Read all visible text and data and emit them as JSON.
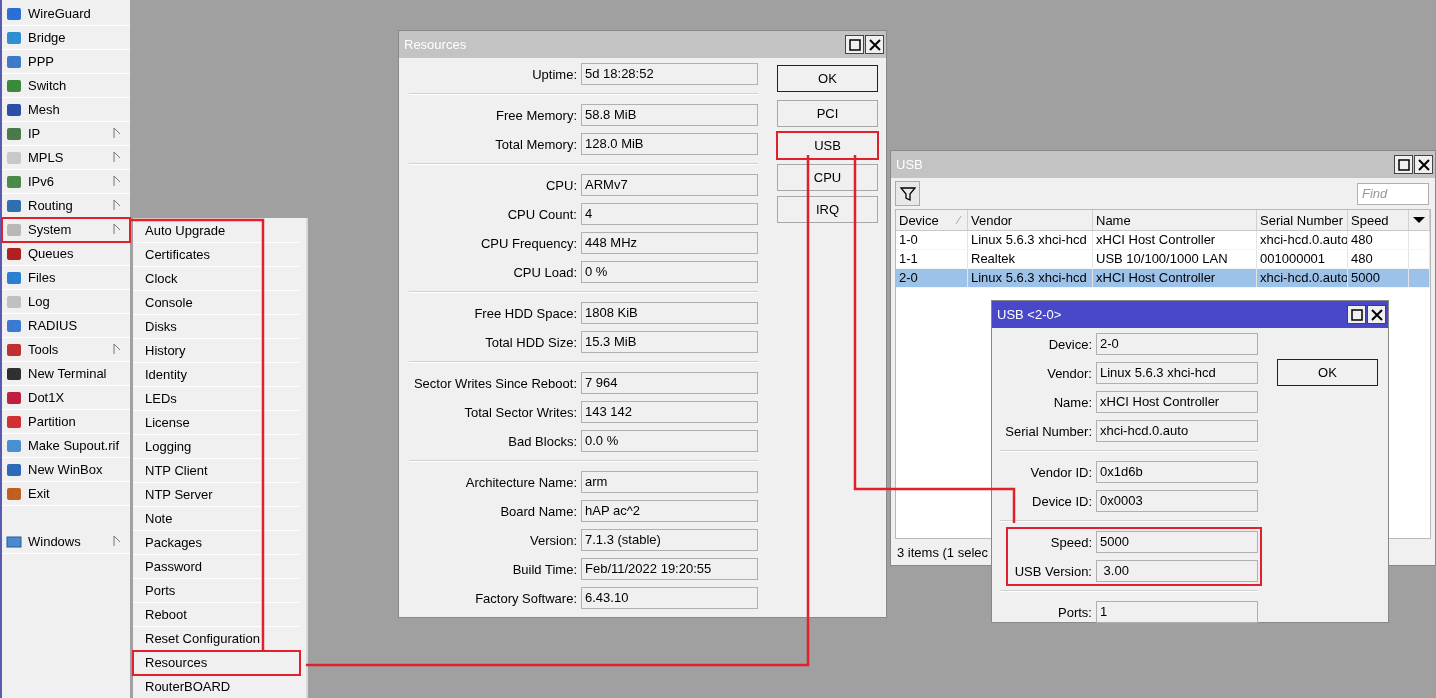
{
  "sidebar": {
    "items": [
      {
        "label": "WireGuard",
        "has_submenu": false,
        "marked": false
      },
      {
        "label": "Bridge",
        "has_submenu": false,
        "marked": false
      },
      {
        "label": "PPP",
        "has_submenu": false,
        "marked": false
      },
      {
        "label": "Switch",
        "has_submenu": false,
        "marked": false
      },
      {
        "label": "Mesh",
        "has_submenu": false,
        "marked": false
      },
      {
        "label": "IP",
        "has_submenu": true,
        "marked": false
      },
      {
        "label": "MPLS",
        "has_submenu": true,
        "marked": false
      },
      {
        "label": "IPv6",
        "has_submenu": true,
        "marked": false
      },
      {
        "label": "Routing",
        "has_submenu": true,
        "marked": false
      },
      {
        "label": "System",
        "has_submenu": true,
        "marked": true
      },
      {
        "label": "Queues",
        "has_submenu": false,
        "marked": false
      },
      {
        "label": "Files",
        "has_submenu": false,
        "marked": false
      },
      {
        "label": "Log",
        "has_submenu": false,
        "marked": false
      },
      {
        "label": "RADIUS",
        "has_submenu": false,
        "marked": false
      },
      {
        "label": "Tools",
        "has_submenu": true,
        "marked": false
      },
      {
        "label": "New Terminal",
        "has_submenu": false,
        "marked": false
      },
      {
        "label": "Dot1X",
        "has_submenu": false,
        "marked": false
      },
      {
        "label": "Partition",
        "has_submenu": false,
        "marked": false
      },
      {
        "label": "Make Supout.rif",
        "has_submenu": false,
        "marked": false
      },
      {
        "label": "New WinBox",
        "has_submenu": false,
        "marked": false
      },
      {
        "label": "Exit",
        "has_submenu": false,
        "marked": false
      }
    ],
    "bottom_items": [
      {
        "label": "Windows",
        "has_submenu": true,
        "marked": false
      }
    ]
  },
  "submenu": {
    "items": [
      {
        "label": "Auto Upgrade",
        "marked": false
      },
      {
        "label": "Certificates",
        "marked": false
      },
      {
        "label": "Clock",
        "marked": false
      },
      {
        "label": "Console",
        "marked": false
      },
      {
        "label": "Disks",
        "marked": false
      },
      {
        "label": "History",
        "marked": false
      },
      {
        "label": "Identity",
        "marked": false
      },
      {
        "label": "LEDs",
        "marked": false
      },
      {
        "label": "License",
        "marked": false
      },
      {
        "label": "Logging",
        "marked": false
      },
      {
        "label": "NTP Client",
        "marked": false
      },
      {
        "label": "NTP Server",
        "marked": false
      },
      {
        "label": "Note",
        "marked": false
      },
      {
        "label": "Packages",
        "marked": false
      },
      {
        "label": "Password",
        "marked": false
      },
      {
        "label": "Ports",
        "marked": false
      },
      {
        "label": "Reboot",
        "marked": false
      },
      {
        "label": "Reset Configuration",
        "marked": false
      },
      {
        "label": "Resources",
        "marked": true
      },
      {
        "label": "RouterBOARD",
        "marked": false
      }
    ]
  },
  "resources": {
    "title": "Resources",
    "groups": [
      {
        "fields": [
          {
            "label": "Uptime:",
            "value": "5d 18:28:52"
          }
        ]
      },
      {
        "fields": [
          {
            "label": "Free Memory:",
            "value": "58.8 MiB"
          },
          {
            "label": "Total Memory:",
            "value": "128.0 MiB"
          }
        ]
      },
      {
        "fields": [
          {
            "label": "CPU:",
            "value": "ARMv7"
          },
          {
            "label": "CPU Count:",
            "value": "4"
          },
          {
            "label": "CPU Frequency:",
            "value": "448 MHz"
          },
          {
            "label": "CPU Load:",
            "value": "0 %"
          }
        ]
      },
      {
        "fields": [
          {
            "label": "Free HDD Space:",
            "value": "1808 KiB"
          },
          {
            "label": "Total HDD Size:",
            "value": "15.3 MiB"
          }
        ]
      },
      {
        "fields": [
          {
            "label": "Sector Writes Since Reboot:",
            "value": "7 964"
          },
          {
            "label": "Total Sector Writes:",
            "value": "143 142"
          },
          {
            "label": "Bad Blocks:",
            "value": "0.0 %"
          }
        ]
      },
      {
        "fields": [
          {
            "label": "Architecture Name:",
            "value": "arm"
          },
          {
            "label": "Board Name:",
            "value": "hAP ac^2"
          },
          {
            "label": "Version:",
            "value": "7.1.3 (stable)"
          },
          {
            "label": "Build Time:",
            "value": "Feb/11/2022 19:20:55"
          },
          {
            "label": "Factory Software:",
            "value": "6.43.10"
          }
        ]
      }
    ],
    "buttons": [
      {
        "label": "OK",
        "default": true,
        "marked": false
      },
      {
        "label": "PCI",
        "default": false,
        "marked": false
      },
      {
        "label": "USB",
        "default": false,
        "marked": true
      },
      {
        "label": "CPU",
        "default": false,
        "marked": false
      },
      {
        "label": "IRQ",
        "default": false,
        "marked": false
      }
    ]
  },
  "usb": {
    "title": "USB",
    "search": {
      "placeholder": "Find"
    },
    "columns": [
      "Device",
      "Vendor",
      "Name",
      "Serial Number",
      "Speed"
    ],
    "rows": [
      {
        "cells": [
          "1-0",
          "Linux 5.6.3 xhci-hcd",
          "xHCI Host Controller",
          "xhci-hcd.0.auto",
          "480"
        ],
        "selected": false
      },
      {
        "cells": [
          "1-1",
          "Realtek",
          "USB 10/100/1000 LAN",
          "001000001",
          "480"
        ],
        "selected": false
      },
      {
        "cells": [
          "2-0",
          "Linux 5.6.3 xhci-hcd",
          "xHCI Host Controller",
          "xhci-hcd.0.auto",
          "5000"
        ],
        "selected": true
      }
    ],
    "status_bar": "3 items (1 selec"
  },
  "usb_detail": {
    "title": "USB <2-0>",
    "active": true,
    "groups": [
      {
        "marked": false,
        "fields": [
          {
            "label": "Device:",
            "value": "2-0"
          },
          {
            "label": "Vendor:",
            "value": "Linux 5.6.3 xhci-hcd"
          },
          {
            "label": "Name:",
            "value": "xHCI Host Controller"
          },
          {
            "label": "Serial Number:",
            "value": "xhci-hcd.0.auto"
          }
        ]
      },
      {
        "marked": false,
        "fields": [
          {
            "label": "Vendor ID:",
            "value": "0x1d6b"
          },
          {
            "label": "Device ID:",
            "value": "0x0003"
          }
        ]
      },
      {
        "marked": true,
        "fields": [
          {
            "label": "Speed:",
            "value": "5000"
          },
          {
            "label": "USB Version:",
            "value": " 3.00"
          }
        ]
      },
      {
        "marked": false,
        "fields": [
          {
            "label": "Ports:",
            "value": "1"
          }
        ]
      }
    ],
    "buttons": [
      {
        "label": "OK",
        "default": true
      }
    ]
  }
}
